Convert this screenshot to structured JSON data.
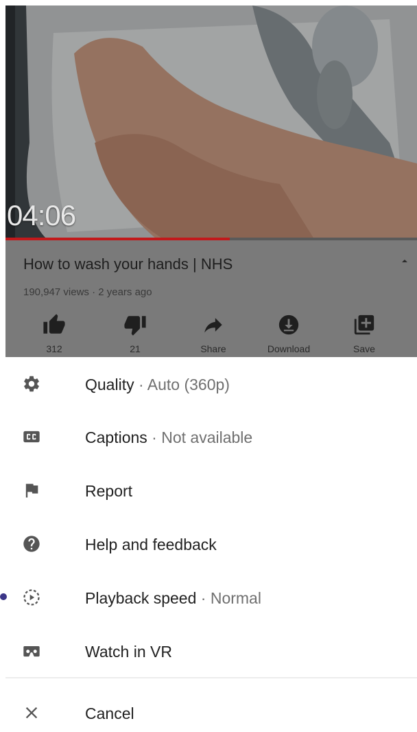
{
  "video": {
    "timestamp": "04:06",
    "progress": 0.545,
    "title": "How to wash your hands | NHS",
    "meta": "190,947 views · 2 years ago"
  },
  "actions": [
    {
      "label": "312",
      "icon": "thumbs-up-icon"
    },
    {
      "label": "21",
      "icon": "thumbs-down-icon"
    },
    {
      "label": "Share",
      "icon": "share-icon"
    },
    {
      "label": "Download",
      "icon": "download-icon"
    },
    {
      "label": "Save",
      "icon": "playlist-add-icon"
    }
  ],
  "menu": {
    "quality": {
      "label": "Quality",
      "value": " · Auto (360p)",
      "icon": "gear-icon"
    },
    "captions": {
      "label": "Captions",
      "value": " · Not available",
      "icon": "closed-captions-icon"
    },
    "report": {
      "label": "Report",
      "icon": "flag-icon"
    },
    "help": {
      "label": "Help and feedback",
      "icon": "help-icon"
    },
    "playback": {
      "label": "Playback speed",
      "value": " · Normal",
      "icon": "playback-speed-icon"
    },
    "vr": {
      "label": "Watch in VR",
      "icon": "vr-headset-icon"
    },
    "cancel": {
      "label": "Cancel",
      "icon": "close-icon"
    }
  },
  "colors": {
    "progress": "#c2191b",
    "overlay": "#7a7a7a",
    "accent_dot": "#3b3688"
  }
}
